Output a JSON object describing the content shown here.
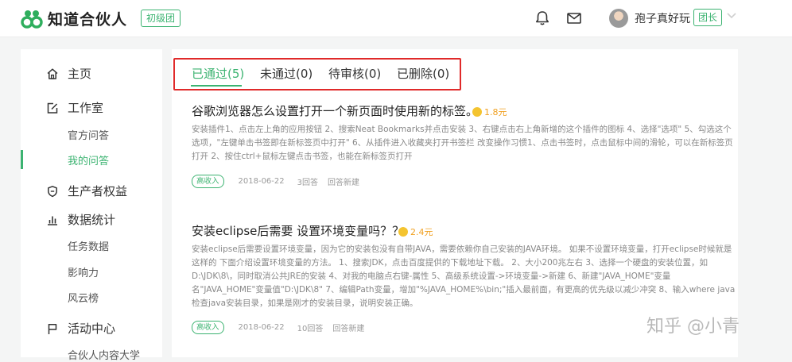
{
  "header": {
    "logo_text": "知道合伙人",
    "level_badge": "初级团",
    "username": "孢子真好玩",
    "role_badge": "团长",
    "icons": [
      "bell-icon",
      "mail-icon",
      "chevron-down-icon"
    ]
  },
  "sidebar": {
    "home": "主页",
    "studio": "工作室",
    "studio_items": [
      "官方问答",
      "我的问答"
    ],
    "rights": "生产者权益",
    "stats": "数据统计",
    "stats_items": [
      "任务数据",
      "影响力",
      "风云榜"
    ],
    "events": "活动中心",
    "events_items": [
      "合伙人内容大学"
    ]
  },
  "tabs": [
    "已通过(5)",
    "未通过(0)",
    "待审核(0)",
    "已删除(0)"
  ],
  "questions": [
    {
      "title": "谷歌浏览器怎么设置打开一个新页面时使用新的标签。",
      "reward": "1.8元",
      "body": "安装插件1、点击左上角的应用按钮 2、搜索Neat Bookmarks并点击安装 3、右键点击右上角新增的这个插件的图标 4、选择\"选项\" 5、勾选这个选项，\"左键单击书签即在新标签页中打开\" 6、从插件进入收藏夹打开书签栏 改变操作习惯1、点击书签时，点击鼠标中间的滑轮，可以在新标签页打开 2、按住ctrl+鼠标左键点击书签，也能在新标签页打开",
      "tag": "高收入",
      "date": "2018-06-22",
      "answers": "3回答",
      "action": "回答新建"
    },
    {
      "title": "安装eclipse后需要 设置环境变量吗？？",
      "reward": "2.4元",
      "body": "安装eclipse后需要设置环境变量，因为它的安装包没有自带JAVA，需要依赖你自己安装的JAVA环境。 如果不设置环境变量，打开eclipse时候就是这样的 下面介绍设置环境变量的方法。 1、搜索JDK，点击百度提供的下载地址下载。 2、大小200兆左右 3、选择一个硬盘的安装位置，如D:\\JDK\\8\\，同时取消公共JRE的安装 4、对我的电脑点右键-属性 5、高级系统设置->环境变量->新建 6、新建\"JAVA_HOME\"变量名\"JAVA_HOME\"变量值\"D:\\JDK\\8\" 7、编辑Path变量，增加\"%JAVA_HOME%\\bin;\"插入最前面，有更高的优先级以减少冲突 8、输入where java 检查java安装目录，如果是刚才的安装目录，说明安装正确。",
      "tag": "高收入",
      "date": "2018-06-22",
      "answers": "10回答",
      "action": "回答新建"
    }
  ],
  "watermark": "知乎 @小青",
  "colors": {
    "accent": "#3cb371",
    "highlight_box": "#e02a2a",
    "reward": "#f0a020"
  }
}
